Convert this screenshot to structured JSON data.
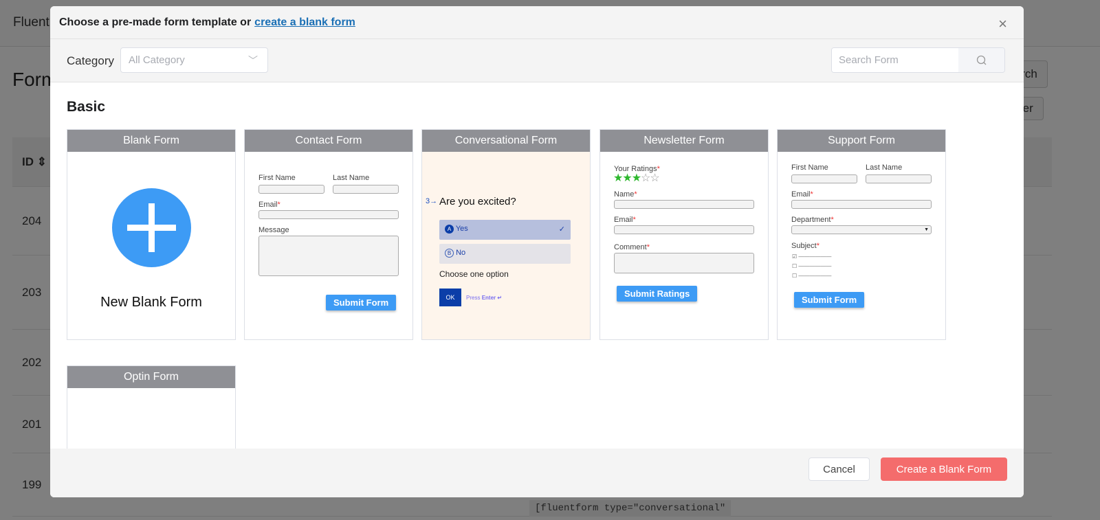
{
  "background": {
    "brand": "Fluent",
    "page_title": "Forms",
    "search_button": "Search",
    "filter_button": "Filter",
    "id_header": "ID",
    "ids": [
      "204",
      "203",
      "202",
      "201",
      "199"
    ],
    "shortcode": "[fluentform type=\"conversational\""
  },
  "modal": {
    "title": "Choose a pre-made form template or",
    "title_link": "create a blank form",
    "close_icon": "×",
    "category_label": "Category",
    "category_value": "All Category",
    "search_placeholder": "Search Form",
    "section": "Basic",
    "cards": {
      "blank": {
        "title": "Blank Form",
        "label": "New Blank Form"
      },
      "contact": {
        "title": "Contact Form",
        "first": "First Name",
        "last": "Last Name",
        "email": "Email",
        "message": "Message",
        "submit": "Submit Form"
      },
      "conv": {
        "title": "Conversational Form",
        "num": "3→",
        "question": "Are you excited?",
        "opt_a_key": "A",
        "opt_a": "Yes",
        "opt_b_key": "B",
        "opt_b": "No",
        "hint": "Choose one option",
        "ok": "OK",
        "press": "Press",
        "enter": "Enter ↵"
      },
      "newsletter": {
        "title": "Newsletter Form",
        "ratings": "Your Ratings",
        "rating_value": 3,
        "rating_max": 5,
        "name": "Name",
        "email": "Email",
        "comment": "Comment",
        "submit": "Submit Ratings"
      },
      "support": {
        "title": "Support Form",
        "first": "First Name",
        "last": "Last Name",
        "email": "Email",
        "department": "Department",
        "subject": "Subject",
        "submit": "Submit Form"
      },
      "optin": {
        "title": "Optin Form"
      }
    },
    "cancel": "Cancel",
    "create": "Create a Blank Form"
  },
  "colors": {
    "accent": "#3d9bf5",
    "danger": "#f46c6c",
    "link": "#1a6fb5",
    "card_header": "#8f9095"
  }
}
